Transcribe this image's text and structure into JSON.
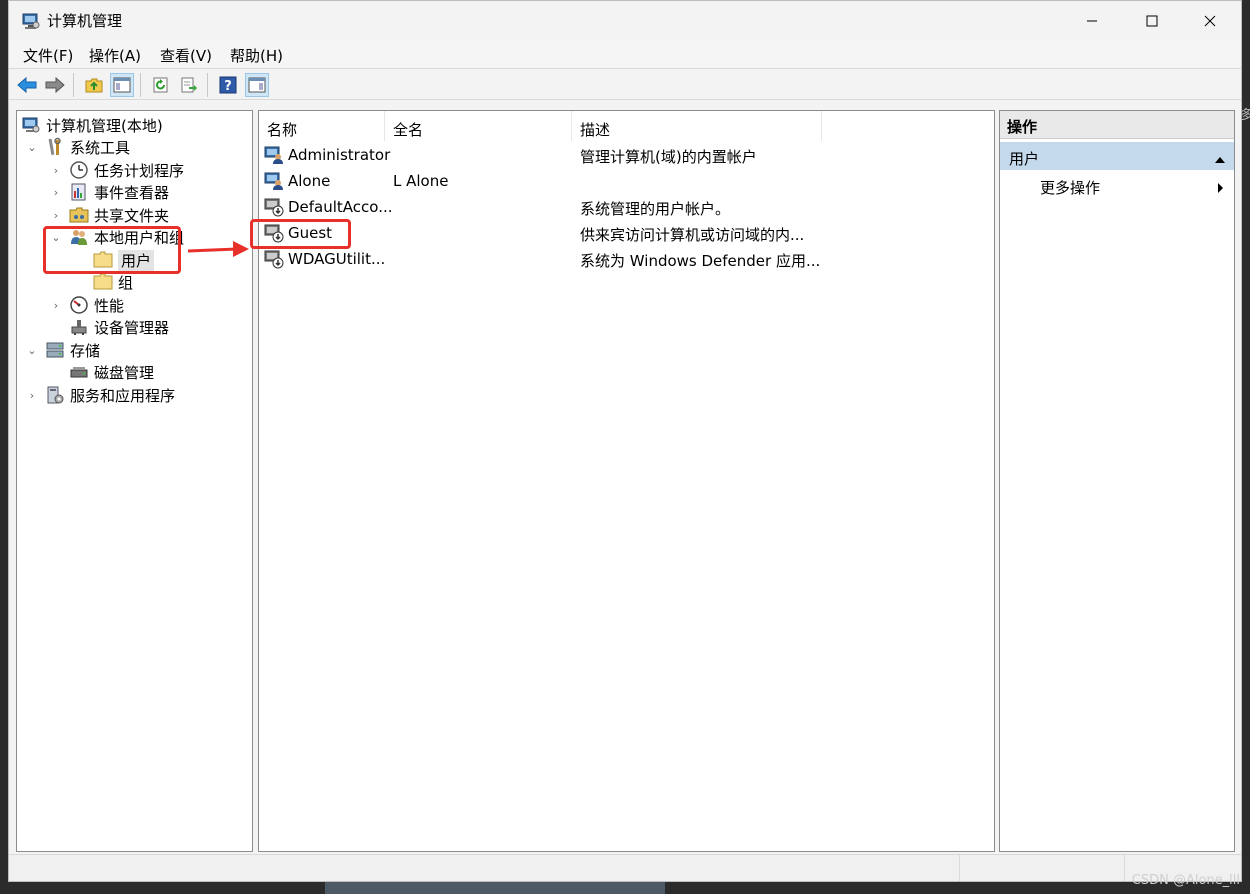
{
  "window": {
    "title": "计算机管理"
  },
  "menu": {
    "file": "文件(F)",
    "action": "操作(A)",
    "view": "查看(V)",
    "help": "帮助(H)"
  },
  "toolbar": {
    "buttons": [
      "back-arrow-icon",
      "forward-arrow-icon",
      "up-folder-icon",
      "show-console-tree-icon",
      "refresh-icon",
      "export-list-icon",
      "help-icon",
      "show-action-pane-icon"
    ]
  },
  "tree": {
    "root": "计算机管理(本地)",
    "system_tools": "系统工具",
    "task_scheduler": "任务计划程序",
    "event_viewer": "事件查看器",
    "shared_folders": "共享文件夹",
    "local_users_groups": "本地用户和组",
    "users": "用户",
    "groups": "组",
    "performance": "性能",
    "device_manager": "设备管理器",
    "storage": "存储",
    "disk_management": "磁盘管理",
    "services_apps": "服务和应用程序"
  },
  "list": {
    "columns": {
      "name": "名称",
      "fullname": "全名",
      "desc": "描述"
    },
    "rows": [
      {
        "name": "Administrator",
        "fullname": "",
        "desc": "管理计算机(域)的内置帐户"
      },
      {
        "name": "Alone",
        "fullname": "L Alone",
        "desc": ""
      },
      {
        "name": "DefaultAcco...",
        "fullname": "",
        "desc": "系统管理的用户帐户。"
      },
      {
        "name": "Guest",
        "fullname": "",
        "desc": "供来宾访问计算机或访问域的内..."
      },
      {
        "name": "WDAGUtilit...",
        "fullname": "",
        "desc": "系统为 Windows Defender 应用..."
      }
    ]
  },
  "actions": {
    "header": "操作",
    "section": "用户",
    "more": "更多操作"
  },
  "watermark": "CSDN @Alone_lll",
  "edge_fragment": "多",
  "colors": {
    "annotation": "#e8302a",
    "selection": "#c5d9ec"
  }
}
